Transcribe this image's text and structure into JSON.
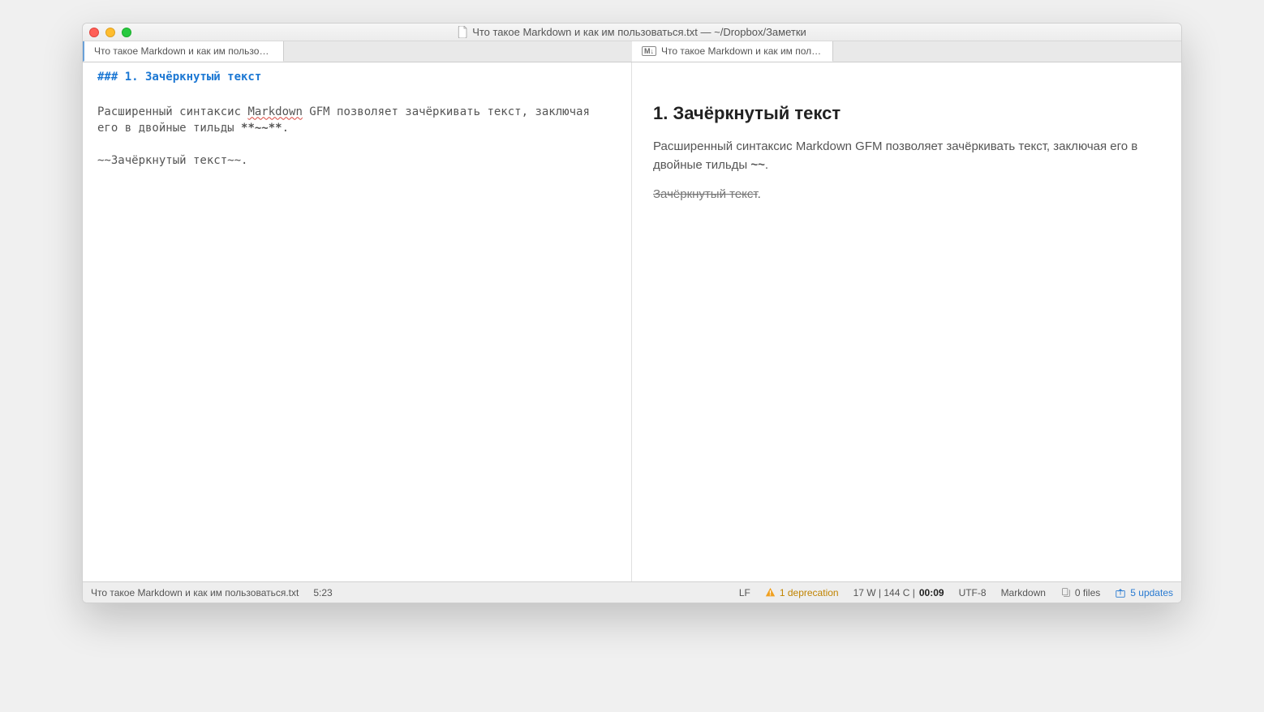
{
  "window": {
    "title": "Что такое Markdown и как им пользоваться.txt — ~/Dropbox/Заметки"
  },
  "tabs": {
    "left_label": "Что такое Markdown и как им пользоват…",
    "right_label": "Что такое Markdown и как им пользова"
  },
  "editor": {
    "heading_raw": "### 1. Зачёркнутый текст",
    "para1_part1": "Расширенный синтаксис ",
    "para1_word": "Markdown",
    "para1_part2": " GFM позволяет зачёркивать текст, заключая его в двойные тильды ",
    "para1_marks": "**~~**",
    "para1_end": ".",
    "line2_raw": "~~Зачёркнутый текст~~."
  },
  "preview": {
    "heading": "1. Зачёркнутый текст",
    "para1_part1": "Расширенный синтаксис Markdown GFM позволяет зачёркивать текст, заключая его в двойные тильды ",
    "para1_bold": "~~",
    "para1_end": ".",
    "strike_text": "Зачёркнутый текст",
    "strike_tail": "."
  },
  "status": {
    "filename": "Что такое Markdown и как им пользоваться.txt",
    "cursor": "5:23",
    "lineend": "LF",
    "deprecation": "1 deprecation",
    "stats_prefix": "17 W | 144 C | ",
    "stats_time": "00:09",
    "encoding": "UTF-8",
    "mode": "Markdown",
    "files": "0 files",
    "updates": "5 updates"
  }
}
